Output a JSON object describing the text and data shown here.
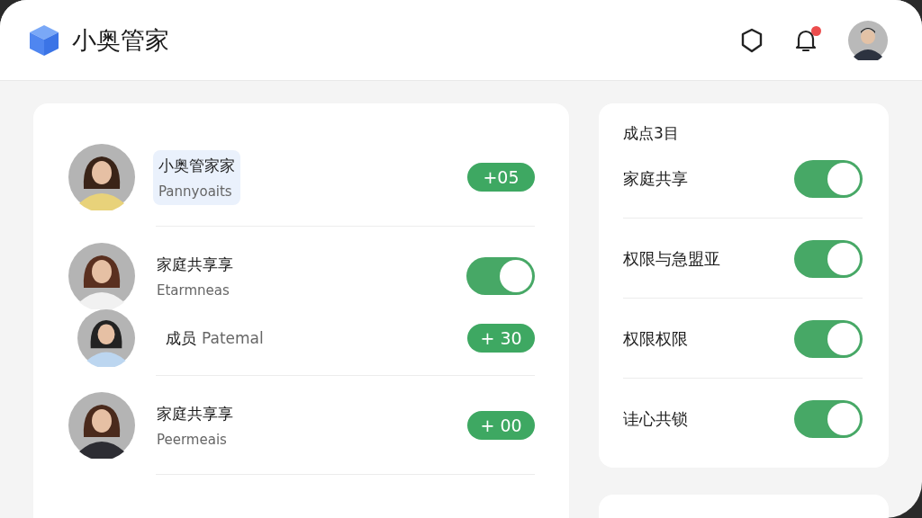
{
  "header": {
    "title": "小奥管家",
    "notification": true
  },
  "members": [
    {
      "name": "小奥管家家",
      "subtitle": "Pannyoaits",
      "selected": true,
      "trailing": {
        "kind": "badge",
        "text": "+05"
      }
    },
    {
      "name": "家庭共享享",
      "subtitle": "Etarmneas",
      "selected": false,
      "trailing": {
        "kind": "toggle",
        "on": true
      }
    },
    {
      "name": "成员",
      "subtitle": "Patemal",
      "selected": false,
      "trailing": {
        "kind": "badge",
        "text": "+ 30"
      }
    },
    {
      "name": "家庭共享享",
      "subtitle": "Peermeais",
      "selected": false,
      "trailing": {
        "kind": "badge",
        "text": "+ 00"
      }
    }
  ],
  "settings": {
    "title": "成点3目",
    "items": [
      {
        "label": "家庭共享",
        "on": true
      },
      {
        "label": "权限与急盟亚",
        "on": true
      },
      {
        "label": "权限权限",
        "on": true
      },
      {
        "label": "诖心共锁",
        "on": true
      }
    ]
  }
}
